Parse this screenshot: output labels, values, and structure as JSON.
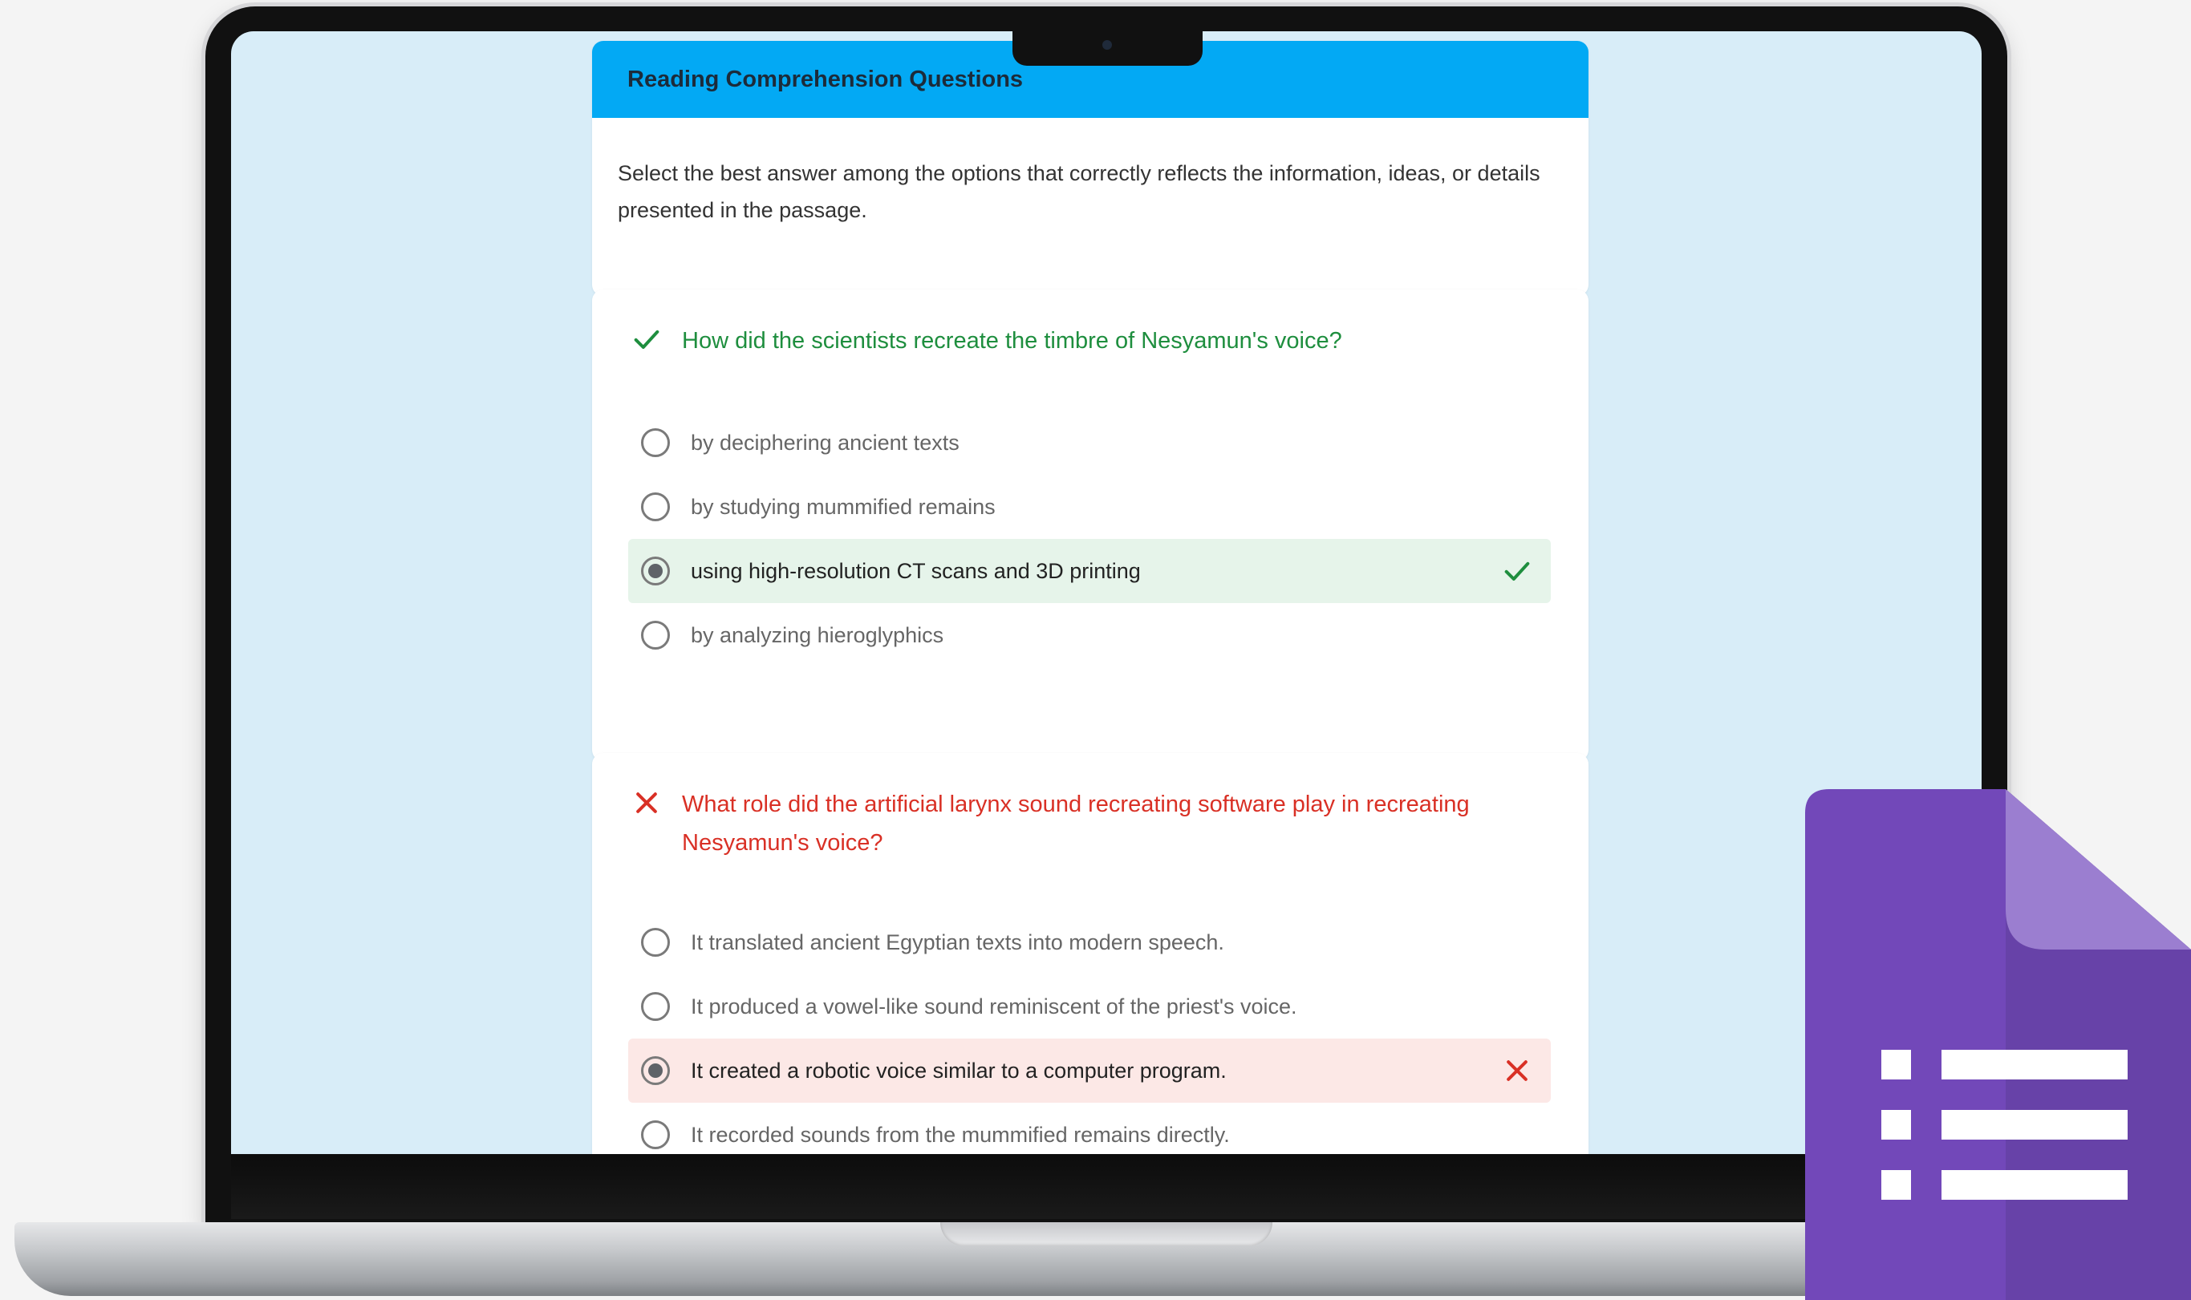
{
  "header": {
    "title": "Reading Comprehension Questions",
    "description": "Select the best answer among the options that correctly reflects the information, ideas, or details presented in the passage."
  },
  "questions": [
    {
      "status": "correct",
      "text": "How did the scientists recreate the timbre of Nesyamun's voice?",
      "options": [
        {
          "label": "by deciphering ancient texts",
          "selected": false
        },
        {
          "label": "by studying mummified remains",
          "selected": false
        },
        {
          "label": "using high-resolution CT scans and 3D printing",
          "selected": true,
          "result": "correct"
        },
        {
          "label": "by analyzing hieroglyphics",
          "selected": false
        }
      ]
    },
    {
      "status": "incorrect",
      "text": "What role did the artificial larynx sound recreating software play in recreating Nesyamun's voice?",
      "options": [
        {
          "label": "It translated ancient Egyptian texts into modern speech.",
          "selected": false
        },
        {
          "label": "It produced a vowel-like sound reminiscent of the priest's voice.",
          "selected": false
        },
        {
          "label": "It created a robotic voice similar to a computer program.",
          "selected": true,
          "result": "incorrect"
        },
        {
          "label": "It recorded sounds from the mummified remains directly.",
          "selected": false
        }
      ]
    }
  ],
  "icons": {
    "correct": "check-icon",
    "incorrect": "close-icon",
    "brand": "google-forms-logo"
  },
  "colors": {
    "header_bar": "#03a9f4",
    "screen_background": "#d8edf8",
    "correct": "#1e8e3e",
    "incorrect": "#d93025",
    "correct_highlight": "#e6f4ea",
    "incorrect_highlight": "#fce8e6",
    "forms_purple": "#7248b9"
  }
}
